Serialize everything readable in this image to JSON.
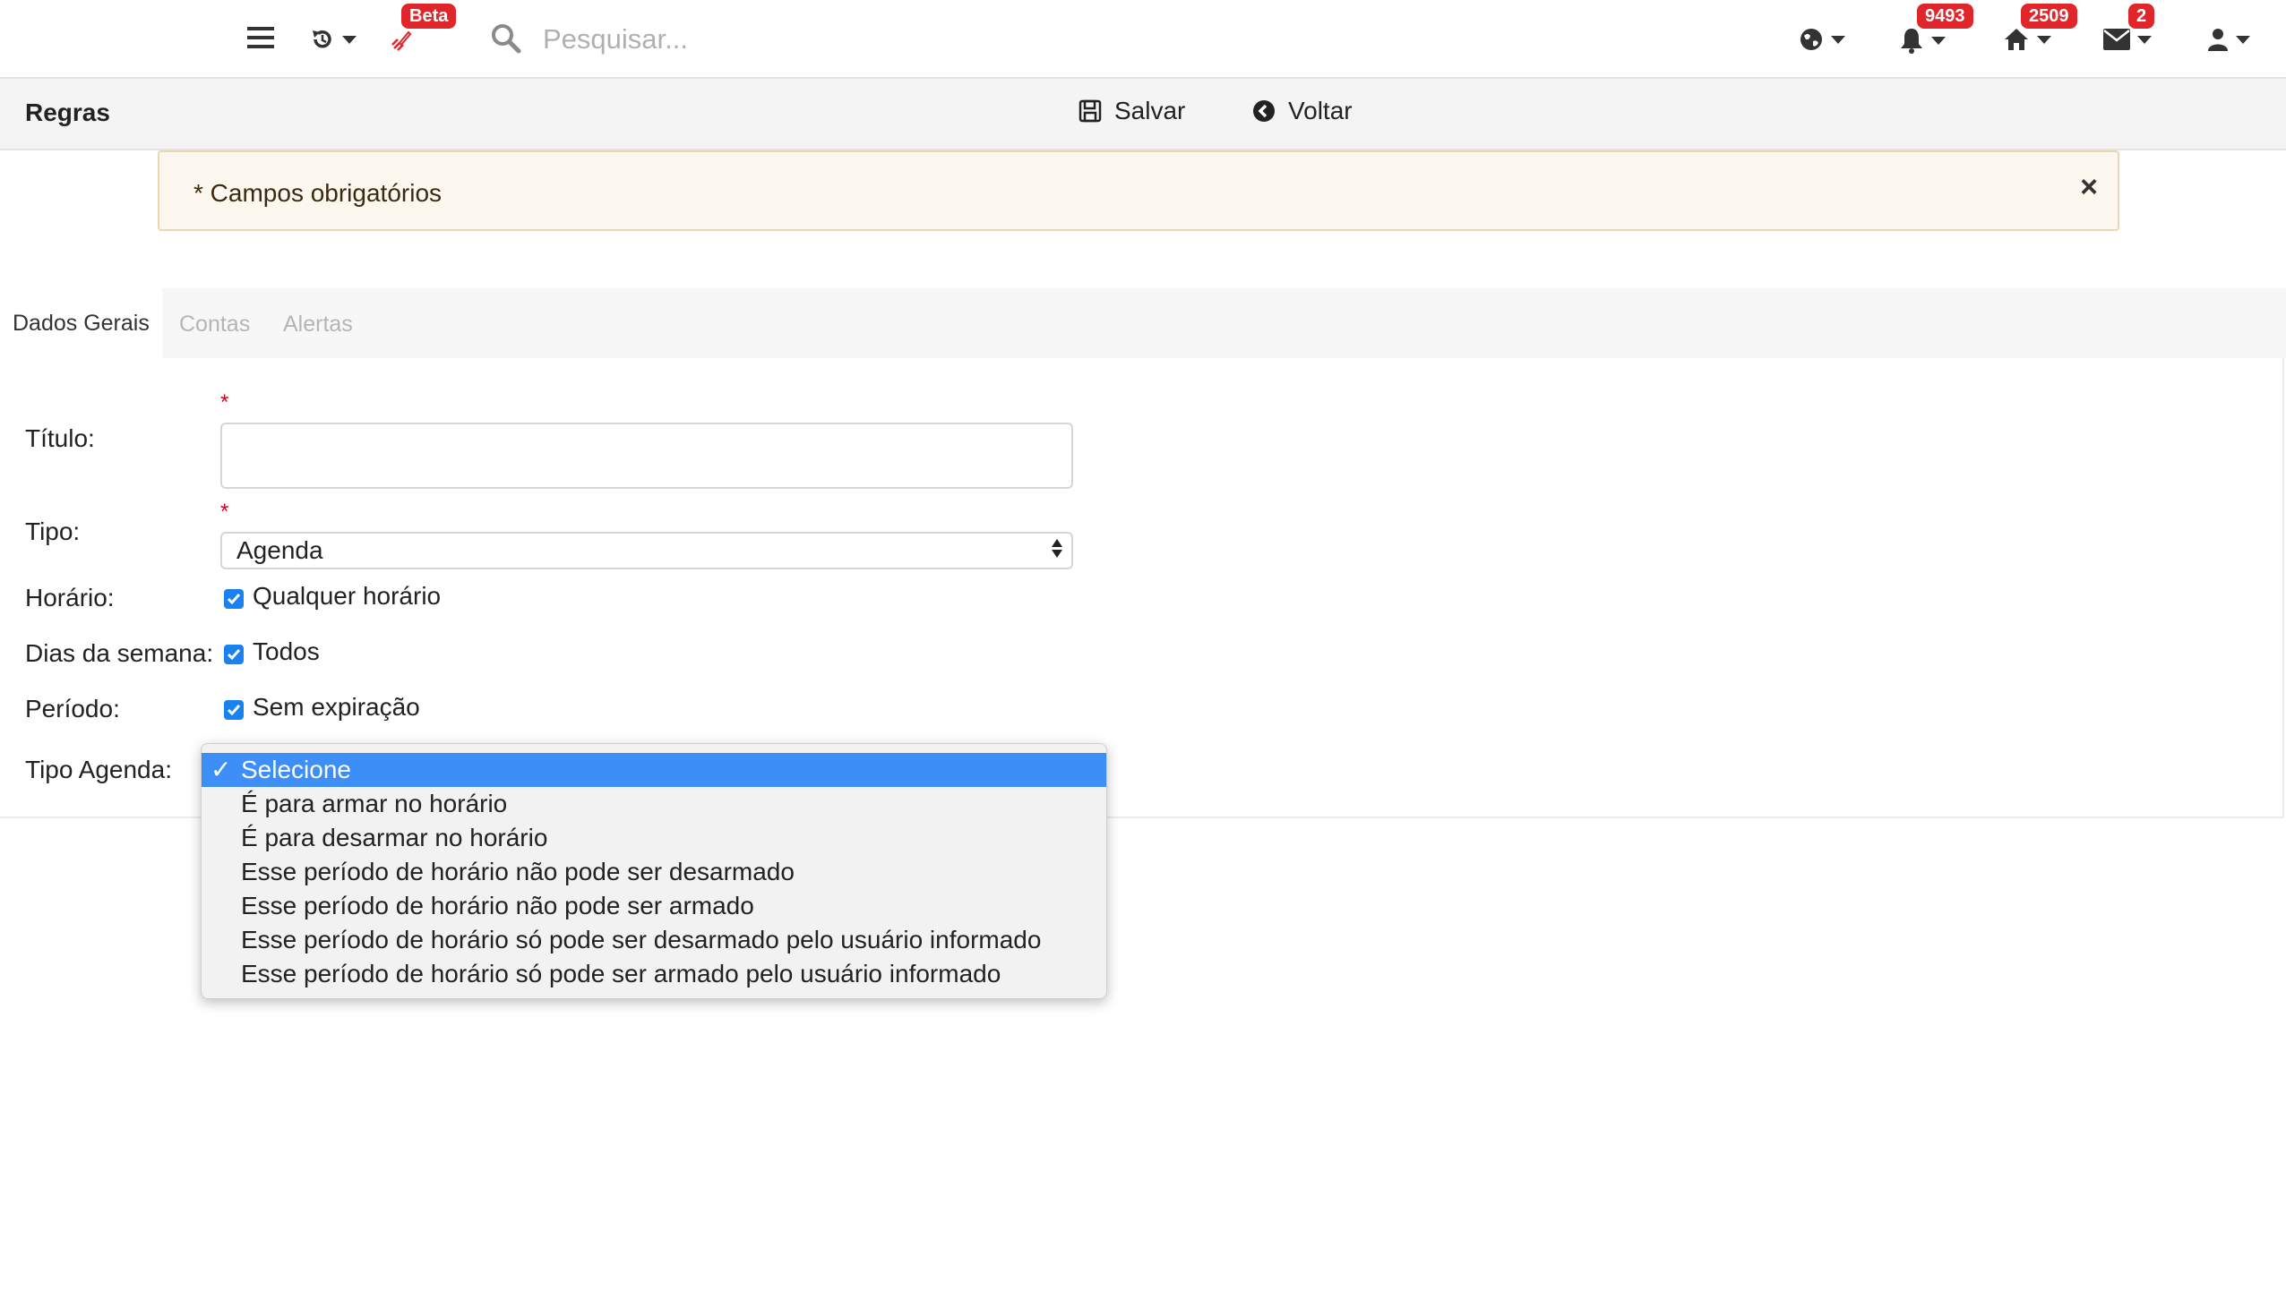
{
  "topbar": {
    "beta_label": "Beta",
    "search_placeholder": "Pesquisar...",
    "notifications_count": "9493",
    "home_count": "2509",
    "messages_count": "2"
  },
  "toolbar": {
    "title": "Regras",
    "save_label": "Salvar",
    "back_label": "Voltar"
  },
  "alert": {
    "text": "* Campos obrigatórios",
    "close": "×"
  },
  "tabs": [
    {
      "label": "Dados Gerais",
      "active": true
    },
    {
      "label": "Contas",
      "active": false
    },
    {
      "label": "Alertas",
      "active": false
    }
  ],
  "form": {
    "required_mark": "*",
    "titulo_label": "Título:",
    "titulo_value": "",
    "tipo_label": "Tipo:",
    "tipo_value": "Agenda",
    "horario_label": "Horário:",
    "horario_check": "Qualquer horário",
    "dias_label": "Dias da semana:",
    "dias_check": "Todos",
    "periodo_label": "Período:",
    "periodo_check": "Sem expiração",
    "tipo_agenda_label": "Tipo Agenda:"
  },
  "dropdown": {
    "check_mark": "✓",
    "options": [
      "Selecione",
      "É para armar no horário",
      "É para desarmar no horário",
      "Esse período de horário não pode ser desarmado",
      "Esse período de horário não pode ser armado",
      "Esse período de horário só pode ser desarmado pelo usuário informado",
      "Esse período de horário só pode ser armado pelo usuário informado"
    ],
    "selected_index": 0
  },
  "colors": {
    "badge": "#e0262a",
    "accent": "#3d8ff7",
    "checkbox": "#1a82f0",
    "required": "#d0021b"
  }
}
